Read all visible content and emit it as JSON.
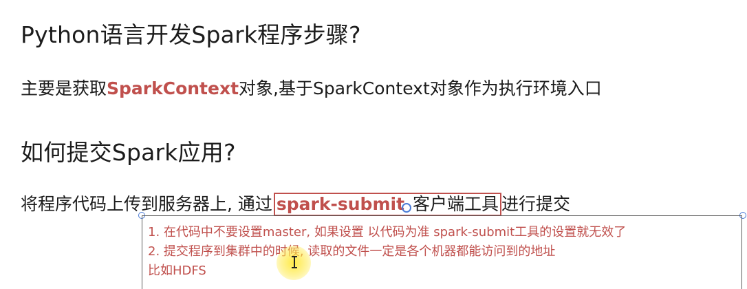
{
  "heading1": "Python语言开发Spark程序步骤?",
  "para1": {
    "before": "主要是获取",
    "highlight": "SparkContext",
    "after": "对象,基于SparkContext对象作为执行环境入口"
  },
  "heading2": "如何提交Spark应用?",
  "para2": {
    "before": "将程序代码上传到服务器上, 通过",
    "highlight": "spark-submit",
    "boxed_rest": "客户端工具",
    "after": "进行提交"
  },
  "note": {
    "line1": "1. 在代码中不要设置master, 如果设置 以代码为准 spark-submit工具的设置就无效了",
    "line2": "2. 提交程序到集群中的时候, 读取的文件一定是各个机器都能访问到的地址",
    "line3": "比如HDFS"
  },
  "colors": {
    "accent": "#c0504d",
    "text": "#1c1c1c",
    "handle": "#4a7bd6",
    "cursor_highlight": "#ffe628"
  },
  "icons": [
    "ibeam-cursor-icon",
    "anchor-icon"
  ]
}
